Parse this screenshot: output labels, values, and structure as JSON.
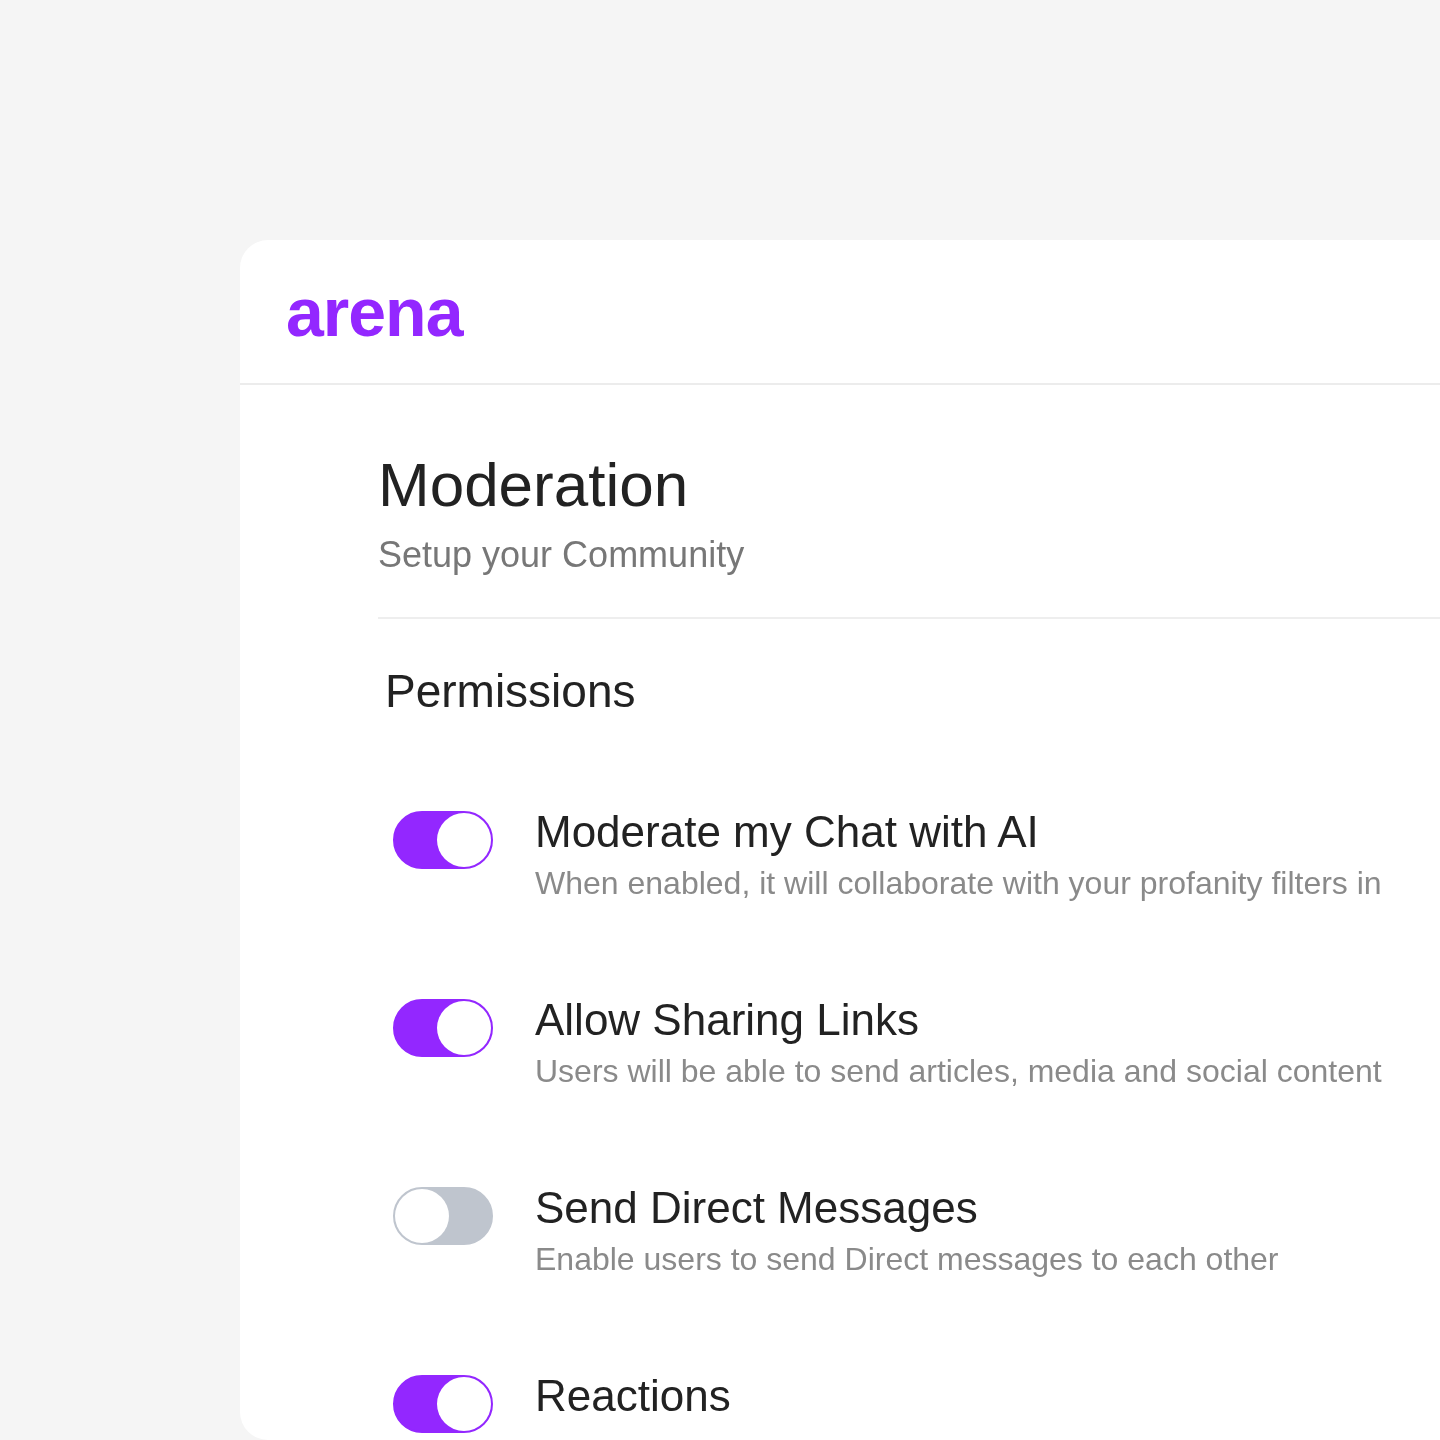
{
  "logo": "arena",
  "page": {
    "title": "Moderation",
    "subtitle": "Setup your Community"
  },
  "section": {
    "title": "Permissions"
  },
  "settings": [
    {
      "title": "Moderate my Chat with AI",
      "description": "When enabled, it will collaborate with your profanity filters in",
      "on": true
    },
    {
      "title": "Allow Sharing Links",
      "description": "Users will be able to send articles, media and social content",
      "on": true
    },
    {
      "title": "Send Direct Messages",
      "description": "Enable users to send Direct messages to each other",
      "on": false
    },
    {
      "title": "Reactions",
      "on": true
    }
  ]
}
